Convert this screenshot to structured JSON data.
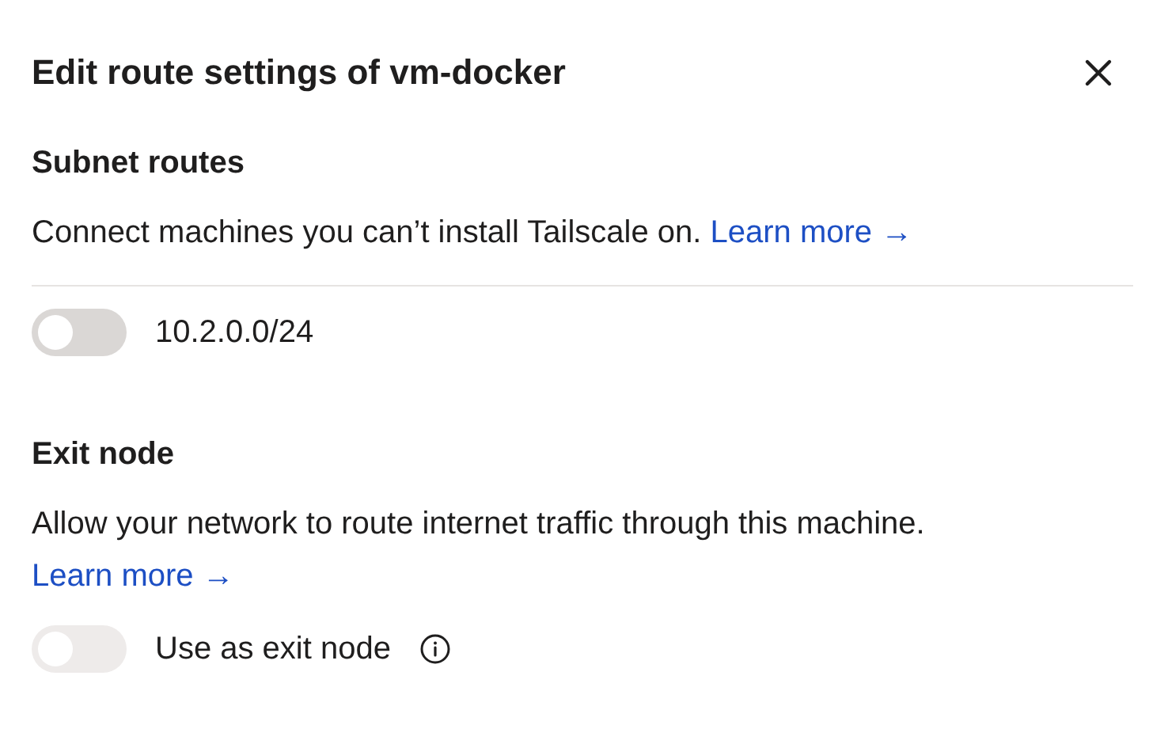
{
  "dialog": {
    "title": "Edit route settings of vm-docker"
  },
  "sections": [
    {
      "heading": "Subnet routes",
      "description": "Connect machines you can’t install Tailscale on.",
      "link": "Learn more →",
      "divider": true,
      "toggles": [
        {
          "label": "10.2.0.0/24",
          "on": false,
          "disabled": false,
          "info": false
        }
      ]
    },
    {
      "heading": "Exit node",
      "description": "Allow your network to route internet traffic through this machine.",
      "link": "Learn more →",
      "divider": false,
      "toggles": [
        {
          "label": "Use as exit node",
          "on": false,
          "disabled": true,
          "info": true
        }
      ]
    }
  ]
}
